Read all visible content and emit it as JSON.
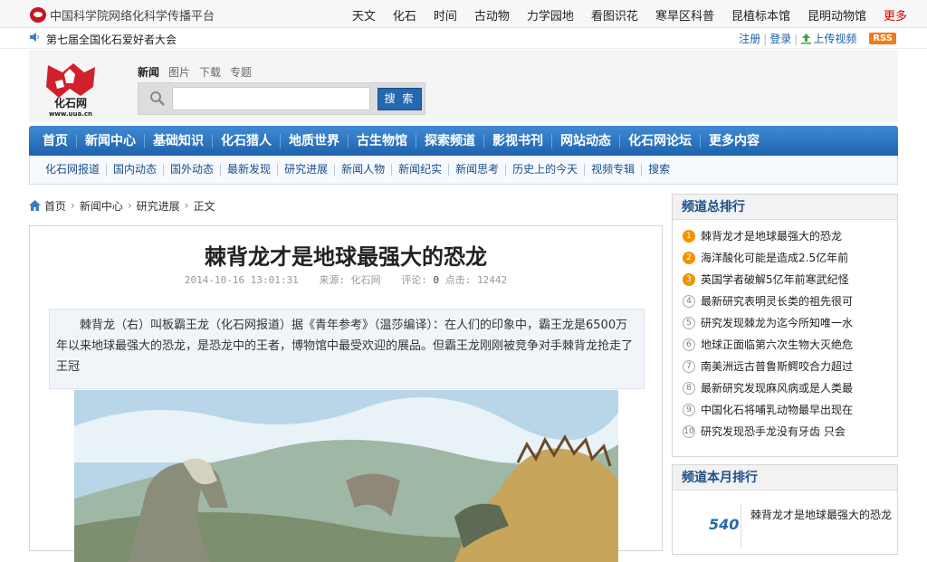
{
  "site": {
    "title": "中国科学院网络化科学传播平台",
    "logo_text": "化石网",
    "logo_url": "www.uua.cn"
  },
  "top_nav": [
    "天文",
    "化石",
    "时间",
    "古动物",
    "力学园地",
    "看图识花",
    "寒旱区科普",
    "昆植标本馆",
    "昆明动物馆"
  ],
  "top_nav_more": "更多",
  "notice": "第七届全国化石爱好者大会",
  "user_links": {
    "register": "注册",
    "login": "登录",
    "upload": "上传视频",
    "rss": "RSS"
  },
  "search": {
    "tabs": [
      "新闻",
      "图片",
      "下载",
      "专题"
    ],
    "button": "搜 索",
    "value": ""
  },
  "main_nav": [
    "首页",
    "新闻中心",
    "基础知识",
    "化石猎人",
    "地质世界",
    "古生物馆",
    "探索频道",
    "影视书刊",
    "网站动态",
    "化石网论坛",
    "更多内容"
  ],
  "sub_nav": [
    "化石网报道",
    "国内动态",
    "国外动态",
    "最新发现",
    "研究进展",
    "新闻人物",
    "新闻纪实",
    "新闻思考",
    "历史上的今天",
    "视频专辑",
    "搜索"
  ],
  "breadcrumb": {
    "home": "首页",
    "level1": "新闻中心",
    "level2": "研究进展",
    "current": "正文"
  },
  "article": {
    "title": "棘背龙才是地球最强大的恐龙",
    "date": "2014-10-16 13:01:31",
    "source": "来源: 化石网",
    "comments_label": "评论:",
    "comments": "0",
    "clicks_label": "点击:",
    "clicks": "12442",
    "summary": "棘背龙（右）叫板霸王龙（化石网报道）据《青年参考》（温莎编译）：在人们的印象中，霸王龙是6500万年以来地球最强大的恐龙，是恐龙中的王者，博物馆中最受欢迎的展品。但霸王龙刚刚被竞争对手棘背龙抢走了王冠"
  },
  "rank": {
    "title": "频道总排行",
    "items": [
      {
        "n": "1",
        "text": "棘背龙才是地球最强大的恐龙"
      },
      {
        "n": "2",
        "text": "海洋酸化可能是造成2.5亿年前"
      },
      {
        "n": "3",
        "text": "英国学者破解5亿年前寒武纪怪"
      },
      {
        "n": "4",
        "text": "最新研究表明灵长类的祖先很可"
      },
      {
        "n": "5",
        "text": "研究发现棘龙为迄今所知唯一水"
      },
      {
        "n": "6",
        "text": "地球正面临第六次生物大灭绝危"
      },
      {
        "n": "7",
        "text": "南美洲远古普鲁斯鳄咬合力超过"
      },
      {
        "n": "8",
        "text": "最新研究发现麻风病或是人类最"
      },
      {
        "n": "9",
        "text": "中国化石将哺乳动物最早出现在"
      },
      {
        "n": "10",
        "text": "研究发现恐手龙没有牙齿 只会"
      }
    ]
  },
  "month": {
    "title": "频道本月排行",
    "count": "540",
    "text": "棘背龙才是地球最强大的恐龙"
  },
  "colors": {
    "accent": "#2368b0",
    "hot": "#f29400",
    "brand_red": "#c4161c"
  }
}
